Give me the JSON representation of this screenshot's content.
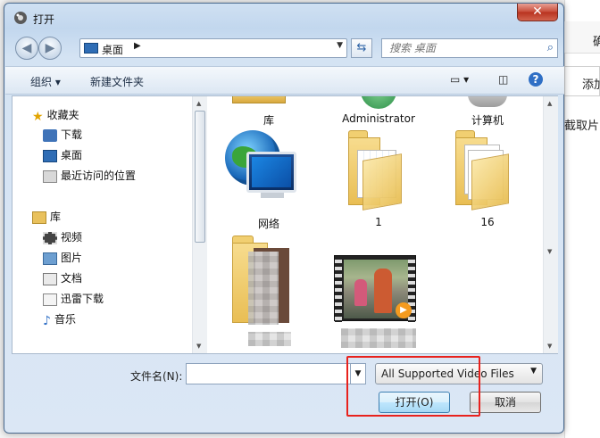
{
  "background": {
    "right_texts": [
      "确",
      "添加",
      "截取片断"
    ]
  },
  "window": {
    "title": "打开",
    "close_label": "✕"
  },
  "nav": {
    "location": "桌面",
    "search_placeholder": "搜索 桌面"
  },
  "toolbar": {
    "organize": "组织 ▾",
    "new_folder": "新建文件夹"
  },
  "sidebar": {
    "favorites": {
      "label": "收藏夹",
      "items": [
        "下载",
        "桌面",
        "最近访问的位置"
      ]
    },
    "libraries": {
      "label": "库",
      "items": [
        "视频",
        "图片",
        "文档",
        "迅雷下载",
        "音乐"
      ]
    }
  },
  "files": [
    {
      "name": "库",
      "type": "library"
    },
    {
      "name": "Administrator",
      "type": "user"
    },
    {
      "name": "计算机",
      "type": "computer"
    },
    {
      "name": "网络",
      "type": "network"
    },
    {
      "name": "1",
      "type": "folder"
    },
    {
      "name": "16",
      "type": "folder"
    },
    {
      "name": "",
      "type": "folder-blurred"
    },
    {
      "name": "",
      "type": "video"
    }
  ],
  "bottom": {
    "filename_label": "文件名(N):",
    "filename_value": "",
    "filetype": "All Supported Video Files",
    "open_label": "打开(O)",
    "cancel_label": "取消"
  },
  "colors": {
    "highlight": "#e8221d",
    "accent": "#2d62a5"
  }
}
